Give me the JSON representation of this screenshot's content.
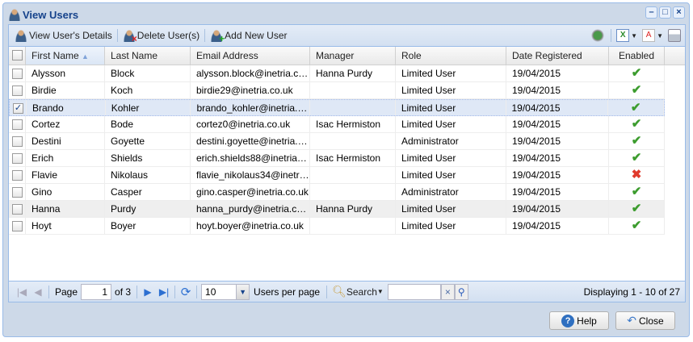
{
  "window": {
    "title": "View Users",
    "controls": [
      "–",
      "□",
      "×"
    ]
  },
  "toolbar": {
    "view": "View User's Details",
    "delete": "Delete User(s)",
    "add": "Add New User",
    "icons": [
      "export-icon",
      "excel-icon",
      "pdf-icon",
      "print-icon"
    ]
  },
  "columns": [
    "First Name",
    "Last Name",
    "Email Address",
    "Manager",
    "Role",
    "Date Registered",
    "Enabled"
  ],
  "rows": [
    {
      "first": "Alysson",
      "last": "Block",
      "email": "alysson.block@inetria.co.uk",
      "manager": "Hanna Purdy",
      "role": "Limited User",
      "date": "19/04/2015",
      "enabled": true,
      "checked": false
    },
    {
      "first": "Birdie",
      "last": "Koch",
      "email": "birdie29@inetria.co.uk",
      "manager": "",
      "role": "Limited User",
      "date": "19/04/2015",
      "enabled": true,
      "checked": false
    },
    {
      "first": "Brando",
      "last": "Kohler",
      "email": "brando_kohler@inetria.co…",
      "manager": "",
      "role": "Limited User",
      "date": "19/04/2015",
      "enabled": true,
      "checked": true
    },
    {
      "first": "Cortez",
      "last": "Bode",
      "email": "cortez0@inetria.co.uk",
      "manager": "Isac Hermiston",
      "role": "Limited User",
      "date": "19/04/2015",
      "enabled": true,
      "checked": false
    },
    {
      "first": "Destini",
      "last": "Goyette",
      "email": "destini.goyette@inetria.co…",
      "manager": "",
      "role": "Administrator",
      "date": "19/04/2015",
      "enabled": true,
      "checked": false
    },
    {
      "first": "Erich",
      "last": "Shields",
      "email": "erich.shields88@inetria.c…",
      "manager": "Isac Hermiston",
      "role": "Limited User",
      "date": "19/04/2015",
      "enabled": true,
      "checked": false
    },
    {
      "first": "Flavie",
      "last": "Nikolaus",
      "email": "flavie_nikolaus34@inetria…",
      "manager": "",
      "role": "Limited User",
      "date": "19/04/2015",
      "enabled": false,
      "checked": false
    },
    {
      "first": "Gino",
      "last": "Casper",
      "email": "gino.casper@inetria.co.uk",
      "manager": "",
      "role": "Administrator",
      "date": "19/04/2015",
      "enabled": true,
      "checked": false
    },
    {
      "first": "Hanna",
      "last": "Purdy",
      "email": "hanna_purdy@inetria.co.uk",
      "manager": "Hanna Purdy",
      "role": "Limited User",
      "date": "19/04/2015",
      "enabled": true,
      "checked": false
    },
    {
      "first": "Hoyt",
      "last": "Boyer",
      "email": "hoyt.boyer@inetria.co.uk",
      "manager": "",
      "role": "Limited User",
      "date": "19/04/2015",
      "enabled": true,
      "checked": false
    }
  ],
  "paging": {
    "page_label": "Page",
    "page": "1",
    "of": "of 3",
    "per_page": "10",
    "per_page_label": "Users per page",
    "search": "Search",
    "search_value": "",
    "display": "Displaying 1 - 10 of 27"
  },
  "buttons": {
    "help": "Help",
    "close": "Close"
  }
}
